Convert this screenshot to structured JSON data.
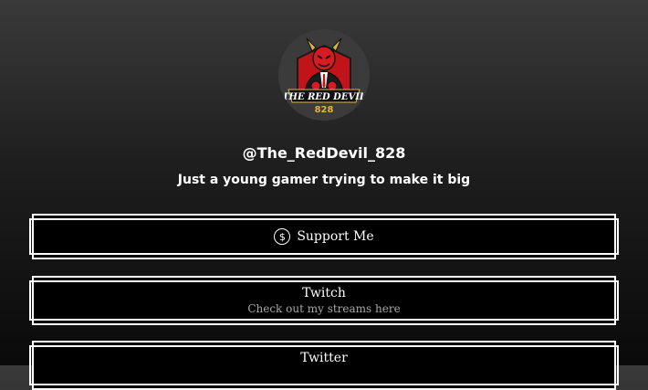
{
  "profile": {
    "handle": "@The_RedDevil_828",
    "bio": "Just a young gamer trying to make it big",
    "avatar_logo_text": "THE RED DEVIL 828"
  },
  "links": [
    {
      "title": "Support Me",
      "icon": "dollar-circle-icon"
    },
    {
      "title": "Twitch",
      "subtitle": "Check out my streams here"
    },
    {
      "title": "Twitter"
    }
  ],
  "colors": {
    "button_bg": "#000000",
    "button_border": "#ffffff",
    "subtitle": "#a8a8a8",
    "avatar_bg": "#3b3b3b",
    "logo_red": "#c0141a",
    "logo_gold": "#e3b23c"
  }
}
